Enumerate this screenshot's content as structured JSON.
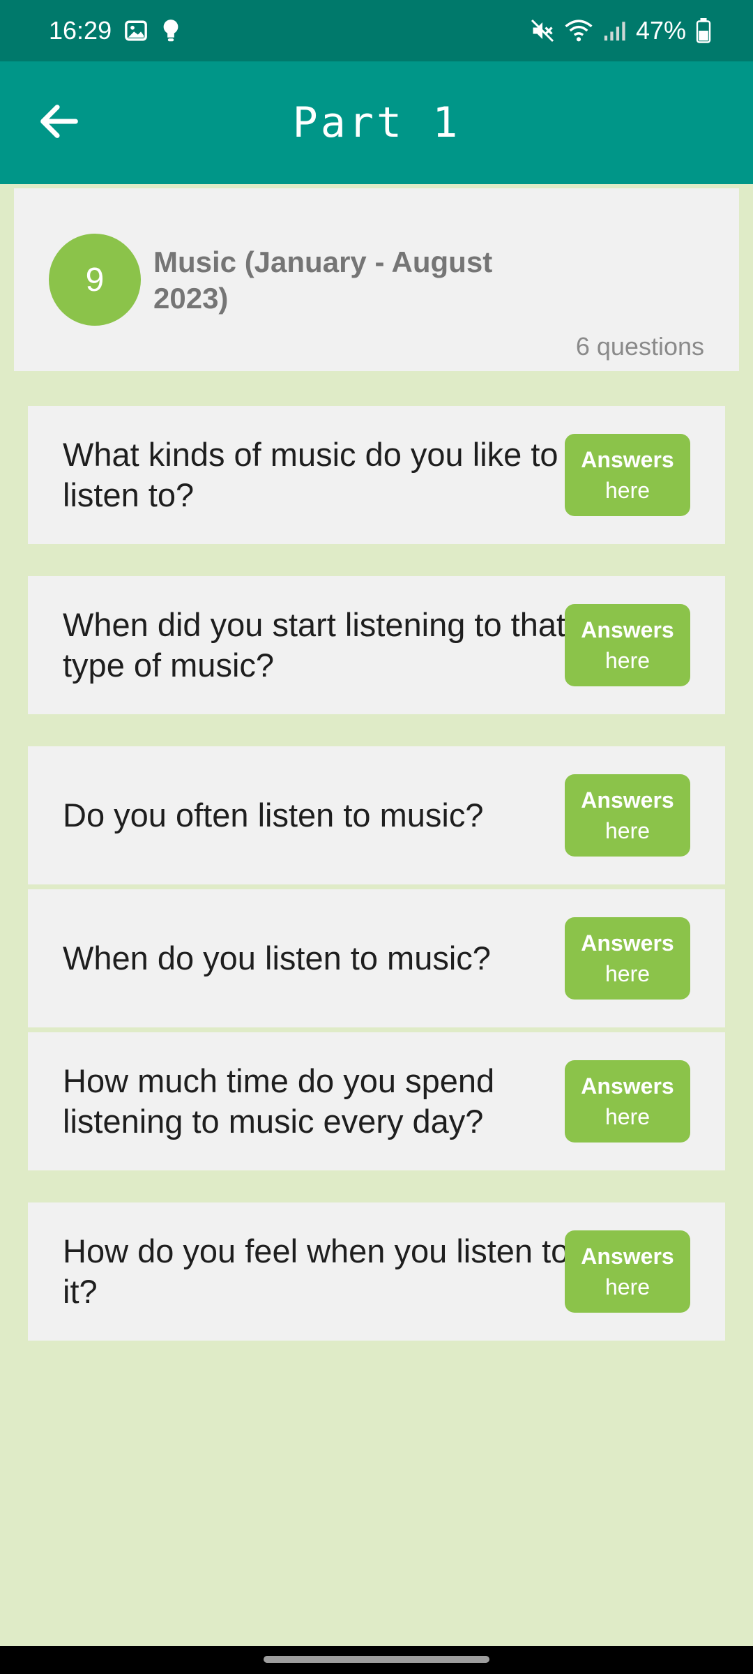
{
  "status_bar": {
    "time": "16:29",
    "battery": "47%",
    "icons": [
      "image-icon",
      "bulb-icon",
      "mute-icon",
      "wifi-icon",
      "signal-icon",
      "battery-icon"
    ]
  },
  "app_bar": {
    "title": "Part 1",
    "back_icon": "arrow-left-icon"
  },
  "topic": {
    "number": "9",
    "title": "Music (January - August 2023)",
    "count": "6 questions"
  },
  "questions": [
    {
      "text": "What kinds of music do you like to listen to?",
      "button_label": "Answers",
      "button_sub": "here"
    },
    {
      "text": "When did you start listening to that type of music?",
      "button_label": "Answers",
      "button_sub": "here"
    },
    {
      "text": "Do you often listen to music?",
      "button_label": "Answers",
      "button_sub": "here"
    },
    {
      "text": "When do you listen to music?",
      "button_label": "Answers",
      "button_sub": "here"
    },
    {
      "text": "How much time do you spend listening to music every day?",
      "button_label": "Answers",
      "button_sub": "here"
    },
    {
      "text": "How do you feel when you listen to it?",
      "button_label": "Answers",
      "button_sub": "here"
    }
  ],
  "colors": {
    "status_bar": "#00796b",
    "app_bar": "#009688",
    "accent_green": "#8bc34a",
    "background": "#dfebc7",
    "card": "#f1f1f1"
  }
}
